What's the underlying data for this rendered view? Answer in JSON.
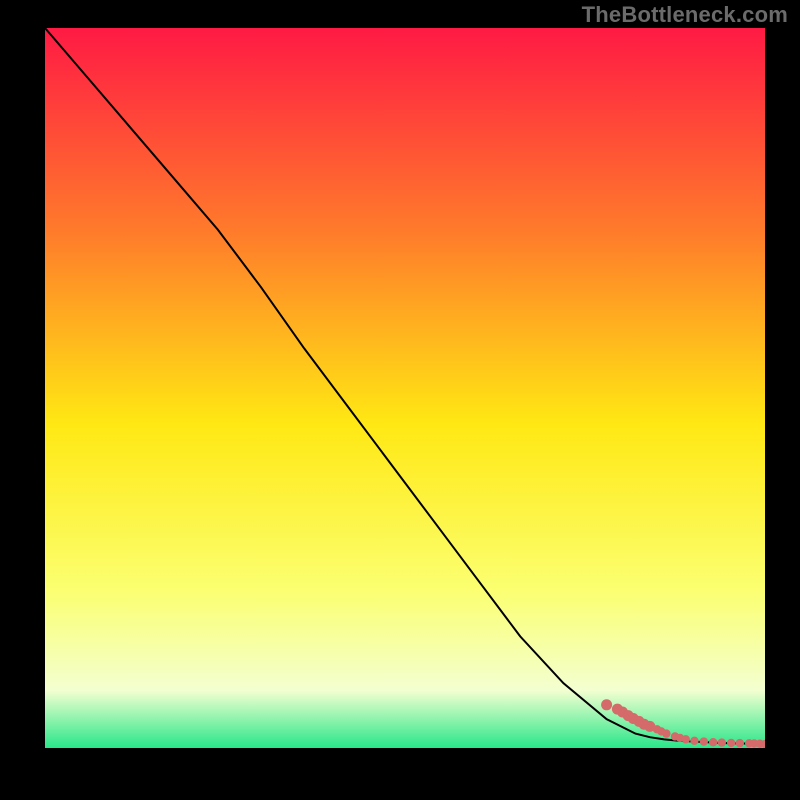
{
  "watermark": "TheBottleneck.com",
  "colors": {
    "background": "#000000",
    "gradient_top": "#ff1a44",
    "gradient_mid_upper": "#ff7a2b",
    "gradient_mid": "#ffe813",
    "gradient_mid_lower": "#fbff70",
    "gradient_lower": "#f3ffd0",
    "gradient_bottom": "#29e78a",
    "line": "#000000",
    "marker": "#d46a6a",
    "watermark": "#6b6b6b"
  },
  "chart_data": {
    "type": "line",
    "title": "",
    "xlabel": "",
    "ylabel": "",
    "xlim": [
      0,
      100
    ],
    "ylim": [
      0,
      100
    ],
    "grid": false,
    "series": [
      {
        "name": "curve",
        "x": [
          0,
          6,
          12,
          18,
          24,
          30,
          36,
          42,
          48,
          54,
          60,
          66,
          72,
          78,
          82,
          84,
          86,
          88,
          90,
          92,
          94,
          96,
          98,
          100
        ],
        "y": [
          100,
          93,
          86,
          79,
          72,
          64,
          55.5,
          47.5,
          39.5,
          31.5,
          23.5,
          15.5,
          9,
          4,
          2,
          1.5,
          1.2,
          1.0,
          0.9,
          0.8,
          0.7,
          0.65,
          0.6,
          0.55
        ]
      }
    ],
    "markers": {
      "name": "cluster",
      "x": [
        78,
        79.5,
        80.2,
        81,
        81.7,
        82.5,
        83.2,
        84,
        85,
        85.6,
        86.3,
        87.5,
        88.2,
        89,
        90.2,
        91.5,
        92.8,
        94,
        95.3,
        96.5,
        97.8,
        98.5,
        99.3,
        100
      ],
      "y": [
        6.0,
        5.4,
        5.0,
        4.5,
        4.1,
        3.7,
        3.3,
        3.0,
        2.6,
        2.3,
        2.0,
        1.6,
        1.4,
        1.2,
        1.0,
        0.9,
        0.8,
        0.75,
        0.7,
        0.68,
        0.65,
        0.63,
        0.6,
        0.55
      ]
    }
  }
}
